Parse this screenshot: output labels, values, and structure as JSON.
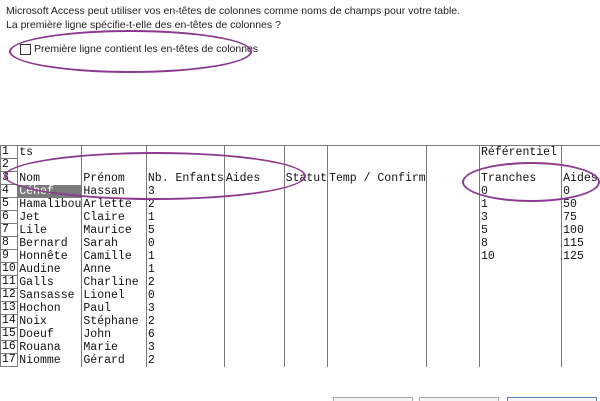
{
  "intro": {
    "line1": "Microsoft Access peut utiliser vos en-têtes de colonnes comme noms de champs pour votre table.",
    "line2": "La première ligne spécifie-t-elle des en-têtes de colonnes ?"
  },
  "header_checkbox": {
    "label": "Première ligne contient les en-têtes de colonnes",
    "checked": false
  },
  "annotation_color": "#8b3a8f",
  "grid": {
    "rows": [
      {
        "num": "1",
        "cells": [
          "ts",
          "",
          "",
          "",
          "",
          "",
          "",
          "Référentiel",
          ""
        ]
      },
      {
        "num": "2",
        "cells": [
          "",
          "",
          "",
          "",
          "",
          "",
          "",
          "",
          ""
        ]
      },
      {
        "num": "3",
        "cells": [
          "Nom",
          "Prénom",
          "Nb. Enfants",
          "Aides",
          "Statut",
          "Temp / Confirm",
          "",
          "Tranches",
          "Aides"
        ]
      },
      {
        "num": "4",
        "cells": [
          "Céhef",
          "Hassan",
          "3",
          "",
          "",
          "",
          "",
          "0",
          "0"
        ]
      },
      {
        "num": "5",
        "cells": [
          "Hamalibou",
          "Arlette",
          "2",
          "",
          "",
          "",
          "",
          "1",
          "50"
        ]
      },
      {
        "num": "6",
        "cells": [
          "Jet",
          "Claire",
          "1",
          "",
          "",
          "",
          "",
          "3",
          "75"
        ]
      },
      {
        "num": "7",
        "cells": [
          "Lile",
          "Maurice",
          "5",
          "",
          "",
          "",
          "",
          "5",
          "100"
        ]
      },
      {
        "num": "8",
        "cells": [
          "Bernard",
          "Sarah",
          "0",
          "",
          "",
          "",
          "",
          "8",
          "115"
        ]
      },
      {
        "num": "9",
        "cells": [
          "Honnête",
          "Camille",
          "1",
          "",
          "",
          "",
          "",
          "10",
          "125"
        ]
      },
      {
        "num": "10",
        "cells": [
          "Audine",
          "Anne",
          "1",
          "",
          "",
          "",
          "",
          "",
          ""
        ]
      },
      {
        "num": "11",
        "cells": [
          "Galls",
          "Charline",
          "2",
          "",
          "",
          "",
          "",
          "",
          ""
        ]
      },
      {
        "num": "12",
        "cells": [
          "Sansasse",
          "Lionel",
          "0",
          "",
          "",
          "",
          "",
          "",
          ""
        ]
      },
      {
        "num": "13",
        "cells": [
          "Hochon",
          "Paul",
          "3",
          "",
          "",
          "",
          "",
          "",
          ""
        ]
      },
      {
        "num": "14",
        "cells": [
          "Noix",
          "Stéphane",
          "2",
          "",
          "",
          "",
          "",
          "",
          ""
        ]
      },
      {
        "num": "15",
        "cells": [
          "Doeuf",
          "John",
          "6",
          "",
          "",
          "",
          "",
          "",
          ""
        ]
      },
      {
        "num": "16",
        "cells": [
          "Rouana",
          "Marie",
          "3",
          "",
          "",
          "",
          "",
          "",
          ""
        ]
      },
      {
        "num": "17",
        "cells": [
          "Niomme",
          "Gérard",
          "2",
          "",
          "",
          "",
          "",
          "",
          ""
        ]
      }
    ],
    "selected_row": 0
  }
}
